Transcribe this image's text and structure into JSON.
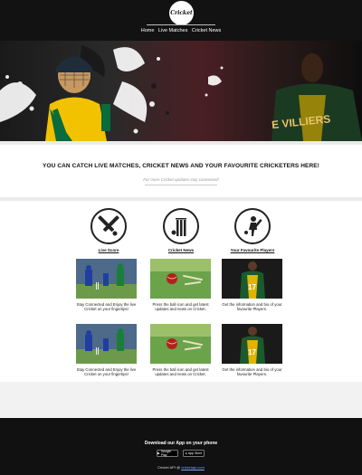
{
  "header": {
    "logo_text": "Cricket",
    "nav": [
      "Home",
      "Live Matches",
      "Cricket News"
    ]
  },
  "hero": {
    "jersey_text": "E VILLIERS"
  },
  "tagline": {
    "heading": "YOU CAN CATCH LIVE MATCHES, CRICKET NEWS AND YOUR FAVOURITE CRICKETERS HERE!",
    "sub": "For more Cricket updates stay connected!"
  },
  "features": [
    {
      "label": "Live Score",
      "icon": "cricket-bats-icon"
    },
    {
      "label": "Cricket News",
      "icon": "stumps-icon"
    },
    {
      "label": "Your Favourite Players",
      "icon": "batsman-icon"
    }
  ],
  "cards": [
    {
      "caption": "Stay Connected and Enjoy the live Cricket on your fingertips!"
    },
    {
      "caption": "Press the ball icon and get latest updates and news on Cricket."
    },
    {
      "caption": "Get the information and bio of your favourite Players."
    },
    {
      "caption": "Stay Connected and Enjoy the live Cricket on your fingertips!"
    },
    {
      "caption": "Press the ball icon and get latest updates and news on Cricket."
    },
    {
      "caption": "Get the information and bio of your favourite Players."
    }
  ],
  "footer": {
    "download": "Download our App on your phone",
    "google_play": "Google Play",
    "app_store": "App Store",
    "copyright_prefix": "Cricket API @",
    "copyright_link": "cricketapi.com"
  },
  "colors": {
    "header_bg": "#121212",
    "footer_bg": "#111111",
    "jersey_yellow": "#f2c200",
    "jersey_green": "#0a6b3c",
    "field_green": "#3f8f2a",
    "ball_red": "#b3201b"
  }
}
